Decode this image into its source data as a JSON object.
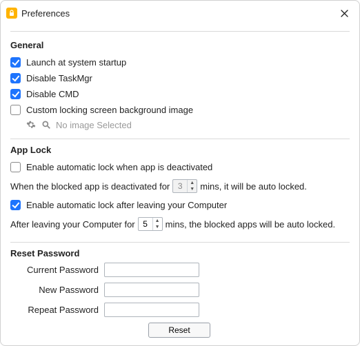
{
  "window": {
    "title": "Preferences"
  },
  "sections": {
    "general": {
      "title": "General",
      "launch_at_startup": {
        "label": "Launch at system startup",
        "checked": true
      },
      "disable_taskmgr": {
        "label": "Disable TaskMgr",
        "checked": true
      },
      "disable_cmd": {
        "label": "Disable CMD",
        "checked": true
      },
      "custom_bg": {
        "label": "Custom locking screen background image",
        "checked": false
      },
      "no_image_text": "No image Selected"
    },
    "applock": {
      "title": "App Lock",
      "auto_lock_deactivated": {
        "label": "Enable automatic lock when app is deactivated",
        "checked": false
      },
      "line1_pre": "When the blocked app is deactivated for",
      "line1_value": "3",
      "line1_post": "mins, it will be auto locked.",
      "auto_lock_leave": {
        "label": "Enable automatic lock after leaving your Computer",
        "checked": true
      },
      "line2_pre": "After leaving your Computer for",
      "line2_value": "5",
      "line2_post": "mins, the blocked apps will be auto locked."
    },
    "reset": {
      "title": "Reset Password",
      "current_label": "Current Password",
      "new_label": "New Password",
      "repeat_label": "Repeat Password",
      "button": "Reset"
    }
  }
}
